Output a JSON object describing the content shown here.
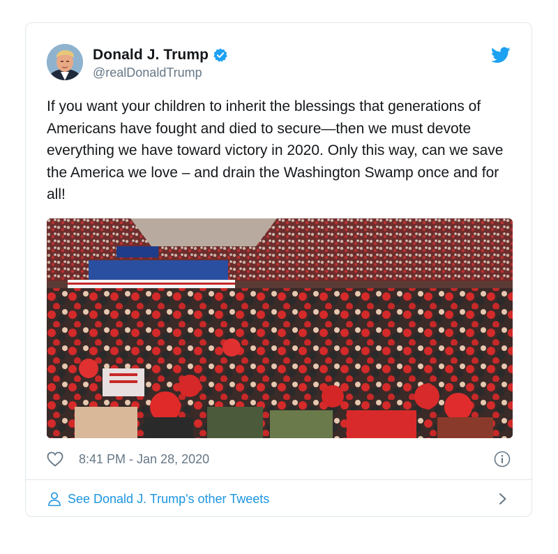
{
  "tweet": {
    "display_name": "Donald J. Trump",
    "handle": "@realDonaldTrump",
    "text": "If you want your children to inherit the blessings that generations of Americans have fought and died to secure—then we must devote everything we have toward victory in 2020. Only this way, can we save the America we love – and drain the Washington Swamp once and for all!",
    "timestamp": "8:41 PM - Jan 28, 2020",
    "other_tweets_label": "See Donald J. Trump's other Tweets"
  },
  "icons": {
    "verified": "verified-badge-icon",
    "brand": "twitter-bird-icon",
    "like": "heart-icon",
    "info": "info-icon",
    "profile": "person-icon",
    "chevron": "chevron-right-icon"
  },
  "colors": {
    "twitter_blue": "#1da1f2",
    "link_blue": "#1b95e0",
    "text_primary": "#14171a",
    "text_secondary": "#657786",
    "border": "#e1e8ed"
  }
}
